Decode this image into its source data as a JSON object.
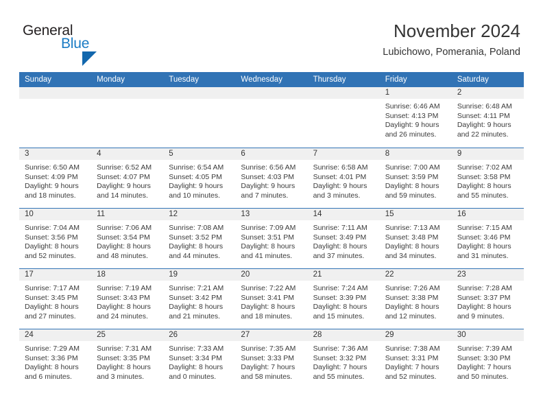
{
  "brand": {
    "name_part1": "General",
    "name_part2": "Blue",
    "colors": {
      "dark": "#231f20",
      "blue": "#1a7bc4",
      "triangle": "#1267ad"
    }
  },
  "header": {
    "month_title": "November 2024",
    "location": "Lubichowo, Pomerania, Poland"
  },
  "theme": {
    "header_row_bg": "#3173b5",
    "header_row_text": "#ffffff",
    "day_band_bg": "#f0f0f0",
    "row_divider": "#3173b5",
    "body_text": "#3a3a3a"
  },
  "weekdays": [
    "Sunday",
    "Monday",
    "Tuesday",
    "Wednesday",
    "Thursday",
    "Friday",
    "Saturday"
  ],
  "weeks": [
    [
      {
        "day": "",
        "empty": true
      },
      {
        "day": "",
        "empty": true
      },
      {
        "day": "",
        "empty": true
      },
      {
        "day": "",
        "empty": true
      },
      {
        "day": "",
        "empty": true
      },
      {
        "day": "1",
        "sunrise": "Sunrise: 6:46 AM",
        "sunset": "Sunset: 4:13 PM",
        "daylight_line1": "Daylight: 9 hours",
        "daylight_line2": "and 26 minutes."
      },
      {
        "day": "2",
        "sunrise": "Sunrise: 6:48 AM",
        "sunset": "Sunset: 4:11 PM",
        "daylight_line1": "Daylight: 9 hours",
        "daylight_line2": "and 22 minutes."
      }
    ],
    [
      {
        "day": "3",
        "sunrise": "Sunrise: 6:50 AM",
        "sunset": "Sunset: 4:09 PM",
        "daylight_line1": "Daylight: 9 hours",
        "daylight_line2": "and 18 minutes."
      },
      {
        "day": "4",
        "sunrise": "Sunrise: 6:52 AM",
        "sunset": "Sunset: 4:07 PM",
        "daylight_line1": "Daylight: 9 hours",
        "daylight_line2": "and 14 minutes."
      },
      {
        "day": "5",
        "sunrise": "Sunrise: 6:54 AM",
        "sunset": "Sunset: 4:05 PM",
        "daylight_line1": "Daylight: 9 hours",
        "daylight_line2": "and 10 minutes."
      },
      {
        "day": "6",
        "sunrise": "Sunrise: 6:56 AM",
        "sunset": "Sunset: 4:03 PM",
        "daylight_line1": "Daylight: 9 hours",
        "daylight_line2": "and 7 minutes."
      },
      {
        "day": "7",
        "sunrise": "Sunrise: 6:58 AM",
        "sunset": "Sunset: 4:01 PM",
        "daylight_line1": "Daylight: 9 hours",
        "daylight_line2": "and 3 minutes."
      },
      {
        "day": "8",
        "sunrise": "Sunrise: 7:00 AM",
        "sunset": "Sunset: 3:59 PM",
        "daylight_line1": "Daylight: 8 hours",
        "daylight_line2": "and 59 minutes."
      },
      {
        "day": "9",
        "sunrise": "Sunrise: 7:02 AM",
        "sunset": "Sunset: 3:58 PM",
        "daylight_line1": "Daylight: 8 hours",
        "daylight_line2": "and 55 minutes."
      }
    ],
    [
      {
        "day": "10",
        "sunrise": "Sunrise: 7:04 AM",
        "sunset": "Sunset: 3:56 PM",
        "daylight_line1": "Daylight: 8 hours",
        "daylight_line2": "and 52 minutes."
      },
      {
        "day": "11",
        "sunrise": "Sunrise: 7:06 AM",
        "sunset": "Sunset: 3:54 PM",
        "daylight_line1": "Daylight: 8 hours",
        "daylight_line2": "and 48 minutes."
      },
      {
        "day": "12",
        "sunrise": "Sunrise: 7:08 AM",
        "sunset": "Sunset: 3:52 PM",
        "daylight_line1": "Daylight: 8 hours",
        "daylight_line2": "and 44 minutes."
      },
      {
        "day": "13",
        "sunrise": "Sunrise: 7:09 AM",
        "sunset": "Sunset: 3:51 PM",
        "daylight_line1": "Daylight: 8 hours",
        "daylight_line2": "and 41 minutes."
      },
      {
        "day": "14",
        "sunrise": "Sunrise: 7:11 AM",
        "sunset": "Sunset: 3:49 PM",
        "daylight_line1": "Daylight: 8 hours",
        "daylight_line2": "and 37 minutes."
      },
      {
        "day": "15",
        "sunrise": "Sunrise: 7:13 AM",
        "sunset": "Sunset: 3:48 PM",
        "daylight_line1": "Daylight: 8 hours",
        "daylight_line2": "and 34 minutes."
      },
      {
        "day": "16",
        "sunrise": "Sunrise: 7:15 AM",
        "sunset": "Sunset: 3:46 PM",
        "daylight_line1": "Daylight: 8 hours",
        "daylight_line2": "and 31 minutes."
      }
    ],
    [
      {
        "day": "17",
        "sunrise": "Sunrise: 7:17 AM",
        "sunset": "Sunset: 3:45 PM",
        "daylight_line1": "Daylight: 8 hours",
        "daylight_line2": "and 27 minutes."
      },
      {
        "day": "18",
        "sunrise": "Sunrise: 7:19 AM",
        "sunset": "Sunset: 3:43 PM",
        "daylight_line1": "Daylight: 8 hours",
        "daylight_line2": "and 24 minutes."
      },
      {
        "day": "19",
        "sunrise": "Sunrise: 7:21 AM",
        "sunset": "Sunset: 3:42 PM",
        "daylight_line1": "Daylight: 8 hours",
        "daylight_line2": "and 21 minutes."
      },
      {
        "day": "20",
        "sunrise": "Sunrise: 7:22 AM",
        "sunset": "Sunset: 3:41 PM",
        "daylight_line1": "Daylight: 8 hours",
        "daylight_line2": "and 18 minutes."
      },
      {
        "day": "21",
        "sunrise": "Sunrise: 7:24 AM",
        "sunset": "Sunset: 3:39 PM",
        "daylight_line1": "Daylight: 8 hours",
        "daylight_line2": "and 15 minutes."
      },
      {
        "day": "22",
        "sunrise": "Sunrise: 7:26 AM",
        "sunset": "Sunset: 3:38 PM",
        "daylight_line1": "Daylight: 8 hours",
        "daylight_line2": "and 12 minutes."
      },
      {
        "day": "23",
        "sunrise": "Sunrise: 7:28 AM",
        "sunset": "Sunset: 3:37 PM",
        "daylight_line1": "Daylight: 8 hours",
        "daylight_line2": "and 9 minutes."
      }
    ],
    [
      {
        "day": "24",
        "sunrise": "Sunrise: 7:29 AM",
        "sunset": "Sunset: 3:36 PM",
        "daylight_line1": "Daylight: 8 hours",
        "daylight_line2": "and 6 minutes."
      },
      {
        "day": "25",
        "sunrise": "Sunrise: 7:31 AM",
        "sunset": "Sunset: 3:35 PM",
        "daylight_line1": "Daylight: 8 hours",
        "daylight_line2": "and 3 minutes."
      },
      {
        "day": "26",
        "sunrise": "Sunrise: 7:33 AM",
        "sunset": "Sunset: 3:34 PM",
        "daylight_line1": "Daylight: 8 hours",
        "daylight_line2": "and 0 minutes."
      },
      {
        "day": "27",
        "sunrise": "Sunrise: 7:35 AM",
        "sunset": "Sunset: 3:33 PM",
        "daylight_line1": "Daylight: 7 hours",
        "daylight_line2": "and 58 minutes."
      },
      {
        "day": "28",
        "sunrise": "Sunrise: 7:36 AM",
        "sunset": "Sunset: 3:32 PM",
        "daylight_line1": "Daylight: 7 hours",
        "daylight_line2": "and 55 minutes."
      },
      {
        "day": "29",
        "sunrise": "Sunrise: 7:38 AM",
        "sunset": "Sunset: 3:31 PM",
        "daylight_line1": "Daylight: 7 hours",
        "daylight_line2": "and 52 minutes."
      },
      {
        "day": "30",
        "sunrise": "Sunrise: 7:39 AM",
        "sunset": "Sunset: 3:30 PM",
        "daylight_line1": "Daylight: 7 hours",
        "daylight_line2": "and 50 minutes."
      }
    ]
  ]
}
